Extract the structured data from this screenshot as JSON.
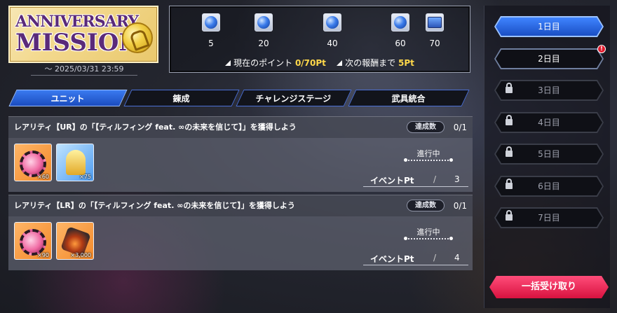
{
  "banner": {
    "title_line1": "ANNIVERSARY",
    "title_line2": "MISSION",
    "date": "〜 2025/03/31 23:59"
  },
  "progress": {
    "rewards": [
      {
        "points": "5",
        "icon": "blue-orb-icon"
      },
      {
        "points": "20",
        "icon": "blue-orb-icon"
      },
      {
        "points": "40",
        "icon": "blue-orb-icon"
      },
      {
        "points": "60",
        "icon": "blue-orb-icon"
      },
      {
        "points": "70",
        "icon": "treasure-chest-icon"
      }
    ],
    "current_label": "現在のポイント",
    "current_value": "0/70Pt",
    "next_label": "次の報酬まで",
    "next_value": "5Pt"
  },
  "tabs": [
    {
      "label": "ユニット",
      "active": true
    },
    {
      "label": "錬成",
      "active": false
    },
    {
      "label": "チャレンジステージ",
      "active": false
    },
    {
      "label": "武具統合",
      "active": false
    }
  ],
  "missions": [
    {
      "title": "レアリティ【UR】の「【ティルフィング feat. ∞の未来を信じて】」を獲得しよう",
      "badge": "達成数",
      "count": "0/1",
      "items": [
        {
          "qty": "×60",
          "icon": "pink-gear-icon"
        },
        {
          "qty": "×75",
          "icon": "golden-grail-icon"
        }
      ],
      "status": "進行中",
      "pt_label": "イベントPt",
      "pt_value": "3"
    },
    {
      "title": "レアリティ【LR】の「【ティルフィング feat. ∞の未来を信じて】」を獲得しよう",
      "badge": "達成数",
      "count": "0/1",
      "items": [
        {
          "qty": "×90",
          "icon": "pink-gear-icon"
        },
        {
          "qty": "×3,000",
          "icon": "fire-ore-icon"
        }
      ],
      "status": "進行中",
      "pt_label": "イベントPt",
      "pt_value": "4"
    }
  ],
  "days": [
    {
      "label": "1日目",
      "state": "active"
    },
    {
      "label": "2日目",
      "state": "available",
      "notification": "!"
    },
    {
      "label": "3日目",
      "state": "locked"
    },
    {
      "label": "4日目",
      "state": "locked"
    },
    {
      "label": "5日目",
      "state": "locked"
    },
    {
      "label": "6日目",
      "state": "locked"
    },
    {
      "label": "7日目",
      "state": "locked"
    }
  ],
  "claim_all_label": "一括受け取り",
  "colors": {
    "accent_blue": "#2b63d9",
    "highlight_yellow": "#ffd84a",
    "claim_pink": "#e8284f"
  }
}
